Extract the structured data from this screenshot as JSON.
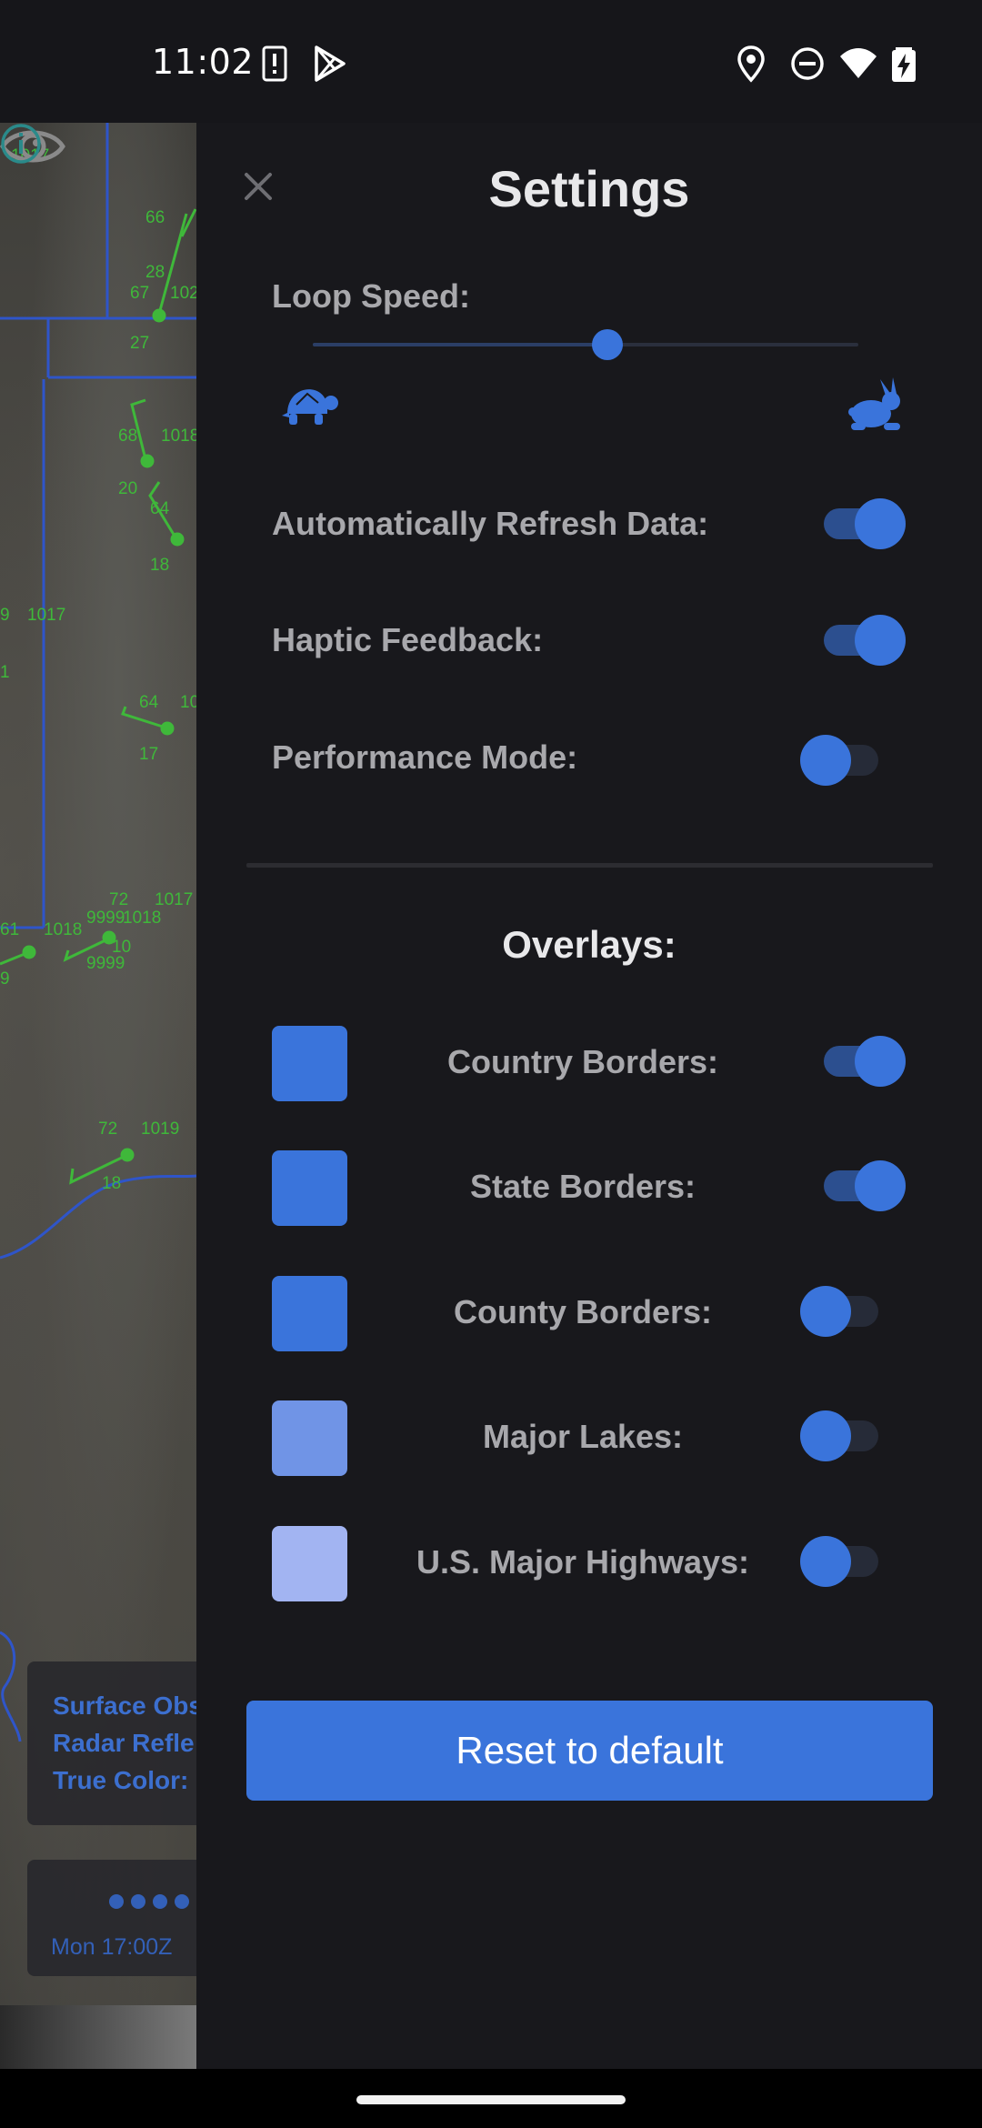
{
  "status_bar": {
    "time": "11:02"
  },
  "map": {
    "legend_lines": [
      "Surface Obs",
      "Radar Refle",
      "True Color:"
    ],
    "time_label": "Mon 17:00Z",
    "station_numbers": [
      "1017",
      "66",
      "28",
      "67",
      "102",
      "27",
      "68",
      "1018",
      "20",
      "64",
      "18",
      "1017",
      "64",
      "10",
      "17",
      "72",
      "1017",
      "9999",
      "1018",
      "10",
      "1018",
      "9999",
      "72",
      "1019",
      "18"
    ]
  },
  "settings": {
    "title": "Settings",
    "loop_speed": {
      "label": "Loop Speed:",
      "value_fraction": 0.54,
      "slow_icon": "turtle-icon",
      "fast_icon": "rabbit-icon"
    },
    "toggles": [
      {
        "key": "auto_refresh",
        "label": "Automatically Refresh Data:",
        "on": true
      },
      {
        "key": "haptic",
        "label": "Haptic Feedback:",
        "on": true
      },
      {
        "key": "performance",
        "label": "Performance Mode:",
        "on": false
      }
    ],
    "overlays_title": "Overlays:",
    "overlays": [
      {
        "label": "Country Borders:",
        "color": "#3a74db",
        "on": true
      },
      {
        "label": "State Borders:",
        "color": "#3a74db",
        "on": true
      },
      {
        "label": "County Borders:",
        "color": "#3a74db",
        "on": false
      },
      {
        "label": "Major Lakes:",
        "color": "#7094e6",
        "on": false
      },
      {
        "label": "U.S. Major Highways:",
        "color": "#a2b4f2",
        "on": false
      }
    ],
    "reset_label": "Reset to default"
  },
  "colors": {
    "accent": "#3a74db",
    "panel": "#18181c",
    "map_line": "#2f55c9",
    "station": "#3fb83a"
  }
}
